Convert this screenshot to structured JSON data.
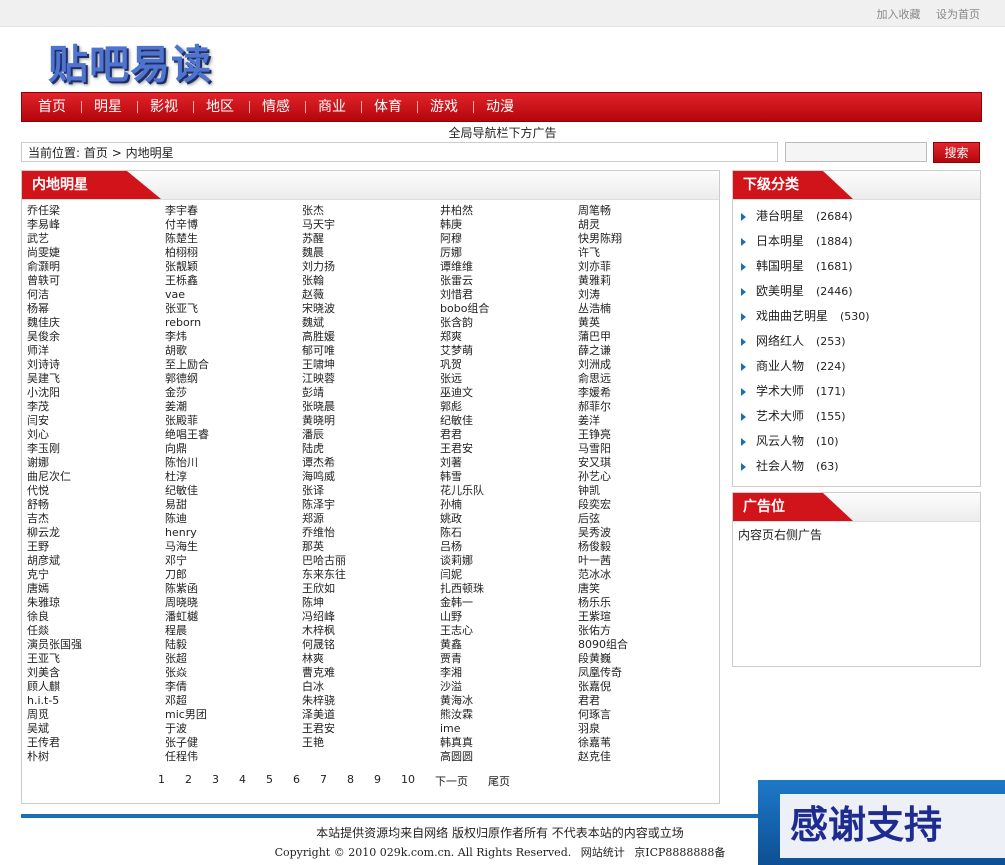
{
  "toplinks": {
    "favorite": "加入收藏",
    "homepage": "设为首页"
  },
  "logo": "贴吧易读",
  "nav": [
    "首页",
    "明星",
    "影视",
    "地区",
    "情感",
    "商业",
    "体育",
    "游戏",
    "动漫"
  ],
  "ad_top": "全局导航栏下方广告",
  "breadcrumb": {
    "label": "当前位置:",
    "home": "首页",
    "sep": ">",
    "current": "内地明星"
  },
  "search": {
    "button": "搜索",
    "value": ""
  },
  "main": {
    "title": "内地明星",
    "columns": [
      [
        "乔任梁",
        "李易峰",
        "武艺",
        "尚雯婕",
        "俞灏明",
        "曾轶可",
        "何洁",
        "杨幂",
        "魏佳庆",
        "吴俊余",
        "师洋",
        "刘诗诗",
        "吴建飞",
        "小沈阳",
        "李茂",
        "闫安",
        "刘心",
        "李玉刚",
        "谢娜",
        "曲尼次仁",
        "代悦",
        "舒畅",
        "吉杰",
        "柳云龙",
        "王野",
        "胡彦斌",
        "克宁",
        "唐嫣",
        "朱雅琼",
        "徐良",
        "任燚",
        "演员张国强",
        "王亚飞",
        "刘美含",
        "顾人麒",
        "h.i.t-5",
        "周觅",
        "吴斌",
        "王传君",
        "朴树"
      ],
      [
        "李宇春",
        "付辛博",
        "陈楚生",
        "柏栩栩",
        "张靓颖",
        "王栎鑫",
        "vae",
        "张亚飞",
        "reborn",
        "李炜",
        "胡歌",
        "至上励合",
        "郭德纲",
        "金莎",
        "姜潮",
        "张殿菲",
        "绝唱王睿",
        "向鼎",
        "陈怡川",
        "杜淳",
        "纪敏佳",
        "易甜",
        "陈迪",
        "henry",
        "马海生",
        "邓宁",
        "刀郎",
        "陈紫函",
        "周晓晓",
        "潘虹樾",
        "程晨",
        "陆毅",
        "张超",
        "张焱",
        "李倩",
        "邓超",
        "mic男团",
        "于波",
        "张子健",
        "任程伟"
      ],
      [
        "张杰",
        "马天宇",
        "苏醒",
        "魏晨",
        "刘力扬",
        "张翰",
        "赵薇",
        "宋晓波",
        "魏斌",
        "高胜媛",
        "郁可唯",
        "王啸坤",
        "江映蓉",
        "彭靖",
        "张晓晨",
        "黄晓明",
        "潘辰",
        "陆虎",
        "谭杰希",
        "海鸣威",
        "张译",
        "陈泽宇",
        "郑源",
        "乔维怡",
        "那英",
        "巴哈古丽",
        "东来东往",
        "王欣如",
        "陈坤",
        "冯绍峰",
        "木梓枫",
        "何晟铭",
        "林爽",
        "曹克难",
        "白冰",
        "朱梓骁",
        "泽美道",
        "王君安",
        "王艳"
      ],
      [
        "井柏然",
        "韩庚",
        "阿穆",
        "厉娜",
        "谭维维",
        "张雷云",
        "刘惜君",
        "bobo组合",
        "张含韵",
        "郑爽",
        "艾梦萌",
        "巩贺",
        "张远",
        "巫迪文",
        "郭彪",
        "纪敏佳",
        "君君",
        "王君安",
        "刘著",
        "韩雪",
        "花儿乐队",
        "孙楠",
        "姚政",
        "陈石",
        "吕杨",
        "谈莉娜",
        "闫妮",
        "扎西顿珠",
        "金韩一",
        "山野",
        "王志心",
        "黄鑫",
        "贾青",
        "李湘",
        "沙溢",
        "黄海冰",
        "熊汝霖",
        "ime",
        "韩真真",
        "高圆圆"
      ],
      [
        "周笔畅",
        "胡灵",
        "快男陈翔",
        "许飞",
        "刘亦菲",
        "黄雅莉",
        "刘涛",
        "丛浩楠",
        "黄英",
        "蒲巴甲",
        "薛之谦",
        "刘洲成",
        "俞思远",
        "李媛希",
        "郝菲尔",
        "姜洋",
        "王铮亮",
        "马雪阳",
        "安又琪",
        "孙艺心",
        "钟凯",
        "段奕宏",
        "后弦",
        "吴秀波",
        "杨俊毅",
        "叶一茜",
        "范冰冰",
        "唐笑",
        "杨乐乐",
        "王紫瑄",
        "张佑方",
        "8090组合",
        "段黄巍",
        "凤凰传奇",
        "张嘉倪",
        "君君",
        "何琢言",
        "羽泉",
        "徐嘉苇",
        "赵克佳"
      ]
    ],
    "pager": [
      "1",
      "2",
      "3",
      "4",
      "5",
      "6",
      "7",
      "8",
      "9",
      "10",
      "下一页",
      "尾页"
    ]
  },
  "subcats": {
    "title": "下级分类",
    "items": [
      {
        "name": "港台明星",
        "count": "(2684)"
      },
      {
        "name": "日本明星",
        "count": "(1884)"
      },
      {
        "name": "韩国明星",
        "count": "(1681)"
      },
      {
        "name": "欧美明星",
        "count": "(2446)"
      },
      {
        "name": "戏曲曲艺明星",
        "count": "(530)"
      },
      {
        "name": "网络红人",
        "count": "(253)"
      },
      {
        "name": "商业人物",
        "count": "(224)"
      },
      {
        "name": "学术大师",
        "count": "(171)"
      },
      {
        "name": "艺术大师",
        "count": "(155)"
      },
      {
        "name": "风云人物",
        "count": "(10)"
      },
      {
        "name": "社会人物",
        "count": "(63)"
      }
    ]
  },
  "adbox": {
    "title": "广告位",
    "text": "内容页右侧广告"
  },
  "footer": {
    "line1": "本站提供资源均来自网络 版权归原作者所有 不代表本站的内容或立场",
    "copyright": "Copyright © 2010 029k.com.cn. All Rights Reserved.",
    "stats": "网站统计",
    "icp": "京ICP8888888备"
  },
  "thanks": "感谢支持"
}
